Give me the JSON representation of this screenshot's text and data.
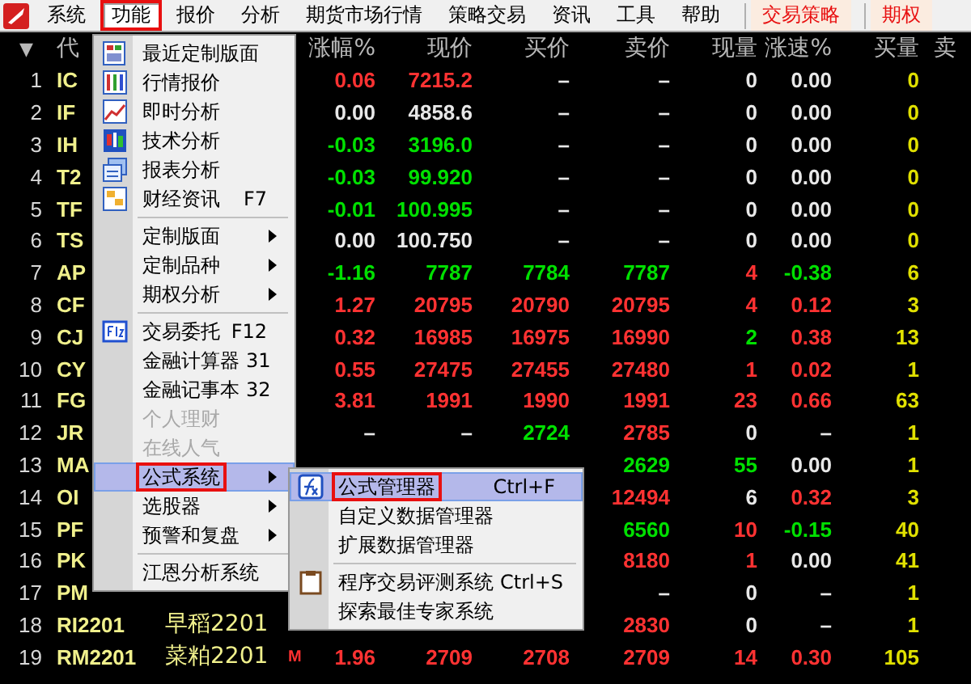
{
  "menubar": [
    {
      "label": "系统",
      "kind": "menu",
      "selected": false,
      "annotated": false
    },
    {
      "label": "功能",
      "kind": "menu",
      "selected": true,
      "annotated": true
    },
    {
      "label": "报价",
      "kind": "menu",
      "selected": false,
      "annotated": false
    },
    {
      "label": "分析",
      "kind": "menu",
      "selected": false,
      "annotated": false
    },
    {
      "label": "期货市场行情",
      "kind": "menu",
      "selected": false,
      "annotated": false
    },
    {
      "label": "策略交易",
      "kind": "menu",
      "selected": false,
      "annotated": false
    },
    {
      "label": "资讯",
      "kind": "menu",
      "selected": false,
      "annotated": false
    },
    {
      "label": "工具",
      "kind": "menu",
      "selected": false,
      "annotated": false
    },
    {
      "label": "帮助",
      "kind": "menu",
      "selected": false,
      "annotated": false
    },
    {
      "label": "交易策略",
      "kind": "accent",
      "selected": false,
      "annotated": false
    },
    {
      "label": "期权",
      "kind": "accent",
      "selected": false,
      "annotated": false
    }
  ],
  "table": {
    "header": [
      "▼",
      "代",
      "涨幅%",
      "现价",
      "买价",
      "卖价",
      "现量",
      "涨速%",
      "买量",
      "卖"
    ],
    "rows": [
      {
        "no": "1",
        "code": "IC",
        "change": {
          "text": "0.06",
          "color": "#ff3232"
        },
        "price": {
          "text": "7215.2",
          "color": "#ff3232"
        },
        "bid": {
          "text": "–",
          "color": "#e8e8e8"
        },
        "ask": {
          "text": "–",
          "color": "#e8e8e8"
        },
        "volume": {
          "text": "0",
          "color": "#e8e8e8"
        },
        "speed": {
          "text": "0.00",
          "color": "#e8e8e8"
        },
        "bid_volume": "0"
      },
      {
        "no": "2",
        "code": "IF",
        "change": {
          "text": "0.00",
          "color": "#e8e8e8"
        },
        "price": {
          "text": "4858.6",
          "color": "#e8e8e8"
        },
        "bid": {
          "text": "–",
          "color": "#e8e8e8"
        },
        "ask": {
          "text": "–",
          "color": "#e8e8e8"
        },
        "volume": {
          "text": "0",
          "color": "#e8e8e8"
        },
        "speed": {
          "text": "0.00",
          "color": "#e8e8e8"
        },
        "bid_volume": "0"
      },
      {
        "no": "3",
        "code": "IH",
        "change": {
          "text": "-0.03",
          "color": "#00e000"
        },
        "price": {
          "text": "3196.0",
          "color": "#00e000"
        },
        "bid": {
          "text": "–",
          "color": "#e8e8e8"
        },
        "ask": {
          "text": "–",
          "color": "#e8e8e8"
        },
        "volume": {
          "text": "0",
          "color": "#e8e8e8"
        },
        "speed": {
          "text": "0.00",
          "color": "#e8e8e8"
        },
        "bid_volume": "0"
      },
      {
        "no": "4",
        "code": "T2",
        "change": {
          "text": "-0.03",
          "color": "#00e000"
        },
        "price": {
          "text": "99.920",
          "color": "#00e000"
        },
        "bid": {
          "text": "–",
          "color": "#e8e8e8"
        },
        "ask": {
          "text": "–",
          "color": "#e8e8e8"
        },
        "volume": {
          "text": "0",
          "color": "#e8e8e8"
        },
        "speed": {
          "text": "0.00",
          "color": "#e8e8e8"
        },
        "bid_volume": "0"
      },
      {
        "no": "5",
        "code": "TF",
        "change": {
          "text": "-0.01",
          "color": "#00e000"
        },
        "price": {
          "text": "100.995",
          "color": "#00e000"
        },
        "bid": {
          "text": "–",
          "color": "#e8e8e8"
        },
        "ask": {
          "text": "–",
          "color": "#e8e8e8"
        },
        "volume": {
          "text": "0",
          "color": "#e8e8e8"
        },
        "speed": {
          "text": "0.00",
          "color": "#e8e8e8"
        },
        "bid_volume": "0"
      },
      {
        "no": "6",
        "code": "TS",
        "change": {
          "text": "0.00",
          "color": "#e8e8e8"
        },
        "price": {
          "text": "100.750",
          "color": "#e8e8e8"
        },
        "bid": {
          "text": "–",
          "color": "#e8e8e8"
        },
        "ask": {
          "text": "–",
          "color": "#e8e8e8"
        },
        "volume": {
          "text": "0",
          "color": "#e8e8e8"
        },
        "speed": {
          "text": "0.00",
          "color": "#e8e8e8"
        },
        "bid_volume": "0"
      },
      {
        "no": "7",
        "code": "AP",
        "change": {
          "text": "-1.16",
          "color": "#00e000"
        },
        "price": {
          "text": "7787",
          "color": "#00e000"
        },
        "bid": {
          "text": "7784",
          "color": "#00e000"
        },
        "ask": {
          "text": "7787",
          "color": "#00e000"
        },
        "volume": {
          "text": "4",
          "color": "#ff3232"
        },
        "speed": {
          "text": "-0.38",
          "color": "#00e000"
        },
        "bid_volume": "6"
      },
      {
        "no": "8",
        "code": "CF",
        "change": {
          "text": "1.27",
          "color": "#ff3232"
        },
        "price": {
          "text": "20795",
          "color": "#ff3232"
        },
        "bid": {
          "text": "20790",
          "color": "#ff3232"
        },
        "ask": {
          "text": "20795",
          "color": "#ff3232"
        },
        "volume": {
          "text": "4",
          "color": "#ff3232"
        },
        "speed": {
          "text": "0.12",
          "color": "#ff3232"
        },
        "bid_volume": "3"
      },
      {
        "no": "9",
        "code": "CJ",
        "change": {
          "text": "0.32",
          "color": "#ff3232"
        },
        "price": {
          "text": "16985",
          "color": "#ff3232"
        },
        "bid": {
          "text": "16975",
          "color": "#ff3232"
        },
        "ask": {
          "text": "16990",
          "color": "#ff3232"
        },
        "volume": {
          "text": "2",
          "color": "#00e000"
        },
        "speed": {
          "text": "0.38",
          "color": "#ff3232"
        },
        "bid_volume": "13"
      },
      {
        "no": "10",
        "code": "CY",
        "change": {
          "text": "0.55",
          "color": "#ff3232"
        },
        "price": {
          "text": "27475",
          "color": "#ff3232"
        },
        "bid": {
          "text": "27455",
          "color": "#ff3232"
        },
        "ask": {
          "text": "27480",
          "color": "#ff3232"
        },
        "volume": {
          "text": "1",
          "color": "#ff3232"
        },
        "speed": {
          "text": "0.02",
          "color": "#ff3232"
        },
        "bid_volume": "1"
      },
      {
        "no": "11",
        "code": "FG",
        "change": {
          "text": "3.81",
          "color": "#ff3232"
        },
        "price": {
          "text": "1991",
          "color": "#ff3232"
        },
        "bid": {
          "text": "1990",
          "color": "#ff3232"
        },
        "ask": {
          "text": "1991",
          "color": "#ff3232"
        },
        "volume": {
          "text": "23",
          "color": "#ff3232"
        },
        "speed": {
          "text": "0.66",
          "color": "#ff3232"
        },
        "bid_volume": "63"
      },
      {
        "no": "12",
        "code": "JR",
        "change": {
          "text": "–",
          "color": "#e8e8e8"
        },
        "price": {
          "text": "–",
          "color": "#e8e8e8"
        },
        "bid": {
          "text": "2724",
          "color": "#00e000"
        },
        "ask": {
          "text": "2785",
          "color": "#ff3232"
        },
        "volume": {
          "text": "0",
          "color": "#e8e8e8"
        },
        "speed": {
          "text": "–",
          "color": "#e8e8e8"
        },
        "bid_volume": "1"
      },
      {
        "no": "13",
        "code": "MA",
        "ask": {
          "text": "2629",
          "color": "#00e000"
        },
        "volume": {
          "text": "55",
          "color": "#00e000"
        },
        "speed": {
          "text": "0.00",
          "color": "#e8e8e8"
        },
        "bid_volume": "1"
      },
      {
        "no": "14",
        "code": "OI",
        "ask": {
          "text": "12494",
          "color": "#ff3232"
        },
        "volume": {
          "text": "6",
          "color": "#e8e8e8"
        },
        "speed": {
          "text": "0.32",
          "color": "#ff3232"
        },
        "bid_volume": "3"
      },
      {
        "no": "15",
        "code": "PF",
        "ask": {
          "text": "6560",
          "color": "#00e000"
        },
        "volume": {
          "text": "10",
          "color": "#ff3232"
        },
        "speed": {
          "text": "-0.15",
          "color": "#00e000"
        },
        "bid_volume": "40"
      },
      {
        "no": "16",
        "code": "PK",
        "ask": {
          "text": "8180",
          "color": "#ff3232"
        },
        "volume": {
          "text": "1",
          "color": "#ff3232"
        },
        "speed": {
          "text": "0.00",
          "color": "#e8e8e8"
        },
        "bid_volume": "41"
      },
      {
        "no": "17",
        "code": "PM",
        "ask": {
          "text": "–",
          "color": "#e8e8e8"
        },
        "volume": {
          "text": "0",
          "color": "#e8e8e8"
        },
        "speed": {
          "text": "–",
          "color": "#e8e8e8"
        },
        "bid_volume": "1"
      },
      {
        "no": "18",
        "code": "RI2201",
        "name": "早稻2201",
        "ask": {
          "text": "2830",
          "color": "#ff3232"
        },
        "volume": {
          "text": "0",
          "color": "#e8e8e8"
        },
        "speed": {
          "text": "–",
          "color": "#e8e8e8"
        },
        "bid_volume": "1"
      },
      {
        "no": "19",
        "code": "RM2201",
        "name": "菜粕2201",
        "marker": "M",
        "change": {
          "text": "1.96",
          "color": "#ff3232"
        },
        "price": {
          "text": "2709",
          "color": "#ff3232"
        },
        "bid": {
          "text": "2708",
          "color": "#ff3232"
        },
        "ask": {
          "text": "2709",
          "color": "#ff3232"
        },
        "volume": {
          "text": "14",
          "color": "#ff3232"
        },
        "speed": {
          "text": "0.30",
          "color": "#ff3232"
        },
        "bid_volume": "105"
      }
    ]
  },
  "menu": {
    "items": [
      {
        "kind": "item",
        "label": "最近定制版面",
        "has_submenu": false,
        "disabled": false,
        "highlighted": false,
        "annotated": false
      },
      {
        "kind": "item",
        "label": "行情报价",
        "has_submenu": false,
        "disabled": false,
        "highlighted": false,
        "annotated": false
      },
      {
        "kind": "item",
        "label": "即时分析",
        "has_submenu": false,
        "disabled": false,
        "highlighted": false,
        "annotated": false
      },
      {
        "kind": "item",
        "label": "技术分析",
        "has_submenu": false,
        "disabled": false,
        "highlighted": false,
        "annotated": false
      },
      {
        "kind": "item",
        "label": "报表分析",
        "has_submenu": false,
        "disabled": false,
        "highlighted": false,
        "annotated": false
      },
      {
        "kind": "item",
        "label": "财经资讯",
        "shortcut": "F7",
        "has_submenu": false,
        "disabled": false,
        "highlighted": false,
        "annotated": false
      },
      {
        "kind": "separator"
      },
      {
        "kind": "item",
        "label": "定制版面",
        "has_submenu": true,
        "disabled": false,
        "highlighted": false,
        "annotated": false
      },
      {
        "kind": "item",
        "label": "定制品种",
        "has_submenu": true,
        "disabled": false,
        "highlighted": false,
        "annotated": false
      },
      {
        "kind": "item",
        "label": "期权分析",
        "has_submenu": true,
        "disabled": false,
        "highlighted": false,
        "annotated": false
      },
      {
        "kind": "separator"
      },
      {
        "kind": "item",
        "label": "交易委托",
        "shortcut": "F12",
        "has_submenu": false,
        "disabled": false,
        "highlighted": false,
        "annotated": false
      },
      {
        "kind": "item",
        "label": "金融计算器",
        "shortcut": "31",
        "has_submenu": false,
        "disabled": false,
        "highlighted": false,
        "annotated": false
      },
      {
        "kind": "item",
        "label": "金融记事本",
        "shortcut": "32",
        "has_submenu": false,
        "disabled": false,
        "highlighted": false,
        "annotated": false
      },
      {
        "kind": "item",
        "label": "个人理财",
        "has_submenu": false,
        "disabled": true,
        "highlighted": false,
        "annotated": false
      },
      {
        "kind": "item",
        "label": "在线人气",
        "has_submenu": false,
        "disabled": true,
        "highlighted": false,
        "annotated": false
      },
      {
        "kind": "item",
        "label": "公式系统",
        "has_submenu": true,
        "disabled": false,
        "highlighted": true,
        "annotated": true
      },
      {
        "kind": "item",
        "label": "选股器",
        "has_submenu": true,
        "disabled": false,
        "highlighted": false,
        "annotated": false
      },
      {
        "kind": "item",
        "label": "预警和复盘",
        "has_submenu": true,
        "disabled": false,
        "highlighted": false,
        "annotated": false
      },
      {
        "kind": "separator"
      },
      {
        "kind": "item",
        "label": "江恩分析系统",
        "has_submenu": false,
        "disabled": false,
        "highlighted": false,
        "annotated": false
      }
    ]
  },
  "submenu": {
    "items": [
      {
        "kind": "item",
        "label": "公式管理器",
        "shortcut": "Ctrl+F",
        "highlighted": true,
        "annotated": true
      },
      {
        "kind": "item",
        "label": "自定义数据管理器",
        "highlighted": false,
        "annotated": false
      },
      {
        "kind": "item",
        "label": "扩展数据管理器",
        "highlighted": false,
        "annotated": false
      },
      {
        "kind": "separator"
      },
      {
        "kind": "item",
        "label": "程序交易评测系统",
        "shortcut": "Ctrl+S",
        "highlighted": false,
        "annotated": false
      },
      {
        "kind": "item",
        "label": "探索最佳专家系统",
        "highlighted": false,
        "annotated": false
      }
    ]
  }
}
